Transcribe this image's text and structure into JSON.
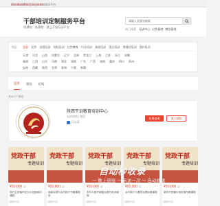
{
  "topbar": {
    "welcome": "您好,欢迎来到干部培训定制服务平台!",
    "date": "2023年03月02日 10:20:05"
  },
  "header": {
    "title": "干部培训定制服务平台",
    "slogan": "找课程、选课程、就上干部培训平台",
    "search_placeholder": "请输入关键字搜索",
    "hot_label": "热门搜索:",
    "hot_keywords": [
      "培训中心",
      "红色基地",
      "教学基地"
    ]
  },
  "filters": {
    "region_label": "地区:",
    "regions": [
      "全部",
      "北京",
      "全国培训",
      "党校培训",
      "红色教育",
      "行业培训",
      "高校培训",
      "国企培训",
      "港澳台培训",
      "境外培训"
    ],
    "province_row1": [
      "天津",
      "河北",
      "山西",
      "内蒙古",
      "辽宁",
      "吉林",
      "黑龙江",
      "上海",
      "江苏",
      "浙江",
      "安徽"
    ],
    "province_row2": [
      "福建",
      "江西",
      "山东",
      "河南",
      "湖北",
      "湖南",
      "广东",
      "广西",
      "海南",
      "重庆",
      "四川",
      "贵州"
    ],
    "province_row3": [
      "云南",
      "西藏",
      "陕西",
      "甘肃",
      "青海",
      "宁夏",
      "新疆"
    ]
  },
  "tabs": [
    "首页",
    "课程",
    "机构"
  ],
  "result_count": "共计1个课程",
  "org": {
    "name": "陕西干训教育培训中心",
    "type": "培训机构 | 陕西",
    "verified": "已认证",
    "consult_label": "在线咨询",
    "enter_label": "进入机构"
  },
  "courses": [
    {
      "banner": "党政干部",
      "banner_sub": "专题培训",
      "price": "¥50,000",
      "unit": "起",
      "title": "现代生态循环农业示范园培训课程",
      "org": "陕西干训"
    },
    {
      "banner": "党政干部",
      "banner_sub": "专题培训",
      "price": "¥50,000",
      "unit": "起",
      "title": "赋能实践与乡村振兴专题课程班",
      "org": "陕西干训"
    },
    {
      "banner": "党政干部",
      "banner_sub": "专题培训",
      "price": "¥50,000",
      "unit": "起",
      "title": "农村人居环境整治提升培训课程",
      "org": "陕西干训"
    },
    {
      "banner": "党政干部",
      "banner_sub": "专题培训",
      "price": "¥50,000",
      "unit": "起",
      "title": "乡村振兴与基层治理实践课程",
      "org": "陕西干训"
    },
    {
      "banner": "党政干部",
      "banner_sub": "专题培训",
      "price": "¥50,000",
      "unit": "起",
      "title": "新时代党建引领发展专题课程",
      "org": "陕西干训"
    }
  ],
  "watermark": {
    "title": "自动秒收录",
    "sub": "一 数上链接 一 未访一次 一 自动收录"
  },
  "colors": {
    "accent": "#e8442e",
    "verify": "#2f6fd6"
  }
}
